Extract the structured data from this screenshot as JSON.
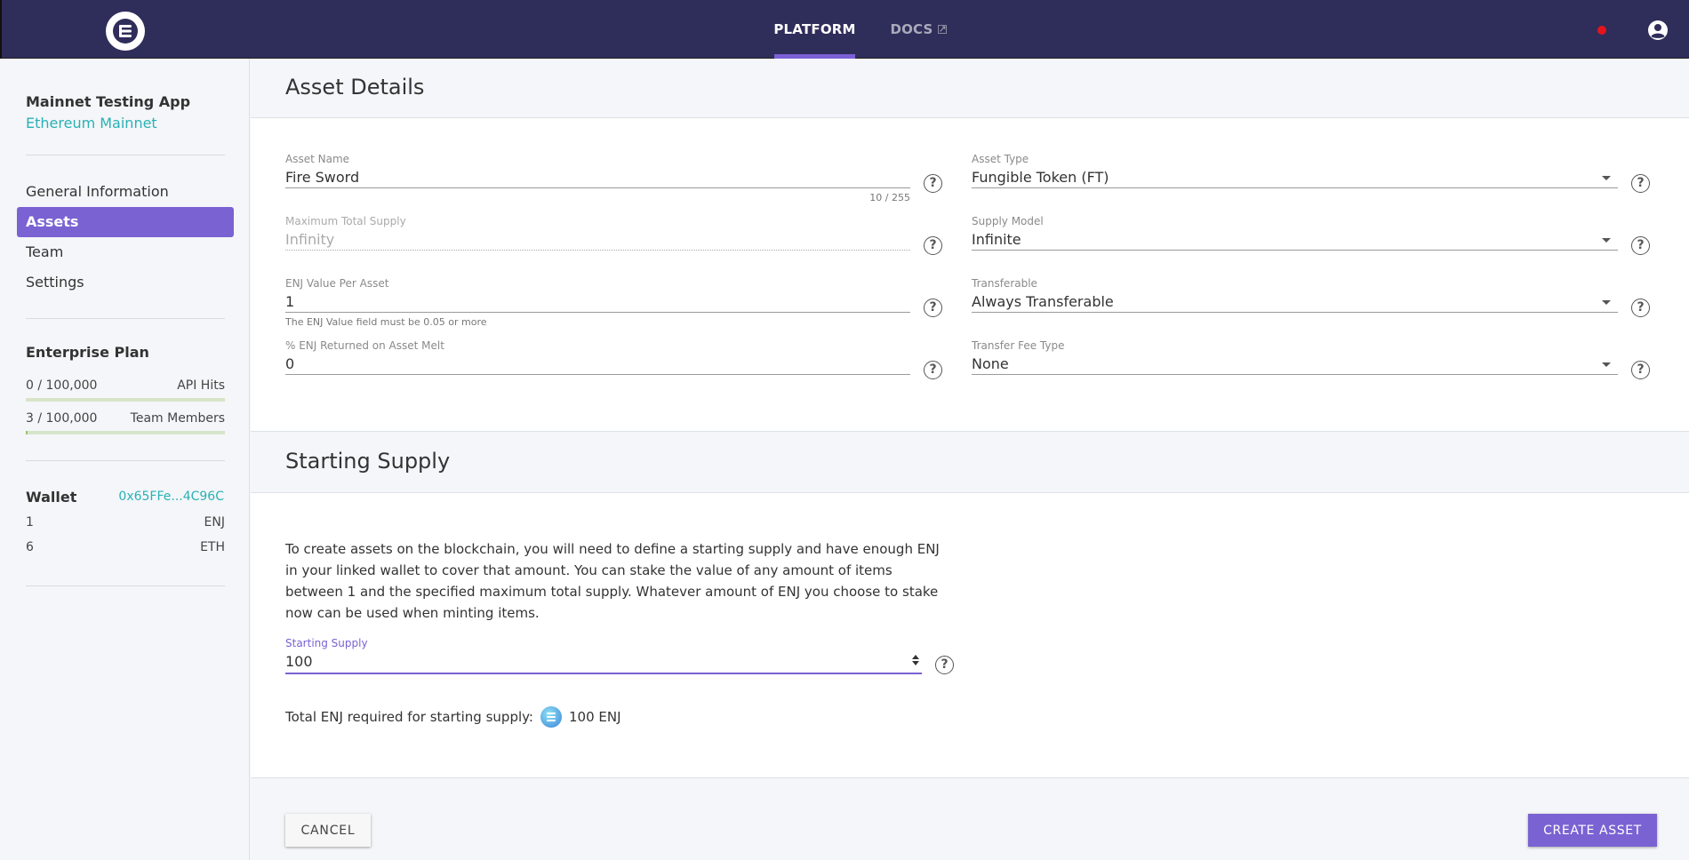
{
  "topbar": {
    "logo_icon": "enjin-logo-icon",
    "tabs": [
      {
        "label": "PLATFORM",
        "active": true
      },
      {
        "label": "DOCS",
        "active": false,
        "icon": "external-link-icon"
      }
    ],
    "notification_color": "#e5141b",
    "account_icon": "account-circle-icon"
  },
  "sidebar": {
    "app_name": "Mainnet Testing App",
    "network": "Ethereum Mainnet",
    "items": [
      {
        "label": "General Information",
        "active": false
      },
      {
        "label": "Assets",
        "active": true
      },
      {
        "label": "Team",
        "active": false
      },
      {
        "label": "Settings",
        "active": false
      }
    ],
    "plan": {
      "title": "Enterprise Plan",
      "usage": [
        {
          "value": "0 / 100,000",
          "label": "API Hits",
          "fraction": 0.0
        },
        {
          "value": "3 / 100,000",
          "label": "Team Members",
          "fraction": 3e-05
        }
      ]
    },
    "wallet": {
      "title": "Wallet",
      "address": "0x65FFe...4C96C",
      "balances": [
        {
          "amount": "1",
          "currency": "ENJ"
        },
        {
          "amount": "6",
          "currency": "ETH"
        }
      ]
    }
  },
  "asset_details": {
    "title": "Asset Details",
    "asset_name": {
      "label": "Asset Name",
      "value": "Fire Sword",
      "counter": "10 / 255"
    },
    "max_supply": {
      "label": "Maximum Total Supply",
      "value": "Infinity"
    },
    "enj_value": {
      "label": "ENJ Value Per Asset",
      "value": "1",
      "hint": "The ENJ Value field must be 0.05 or more"
    },
    "enj_returned": {
      "label": "% ENJ Returned on Asset Melt",
      "value": "0"
    },
    "asset_type": {
      "label": "Asset Type",
      "value": "Fungible Token (FT)"
    },
    "supply_model": {
      "label": "Supply Model",
      "value": "Infinite"
    },
    "transferable": {
      "label": "Transferable",
      "value": "Always Transferable"
    },
    "transfer_fee": {
      "label": "Transfer Fee Type",
      "value": "None"
    },
    "help_glyph": "?"
  },
  "starting_supply": {
    "title": "Starting Supply",
    "description": "To create assets on the blockchain, you will need to define a starting supply and have enough ENJ in your linked wallet to cover that amount. You can stake the value of any amount of items between 1 and the specified maximum total supply. Whatever amount of ENJ you choose to stake now can be used when minting items.",
    "field_label": "Starting Supply",
    "field_value": "100",
    "total_label": "Total ENJ required for starting supply:",
    "total_value": "100 ENJ"
  },
  "footer": {
    "cancel_label": "CANCEL",
    "create_label": "CREATE ASSET"
  },
  "colors": {
    "topbar": "#2f2d5a",
    "accent": "#7a62d3",
    "link": "#2ab1b5"
  }
}
